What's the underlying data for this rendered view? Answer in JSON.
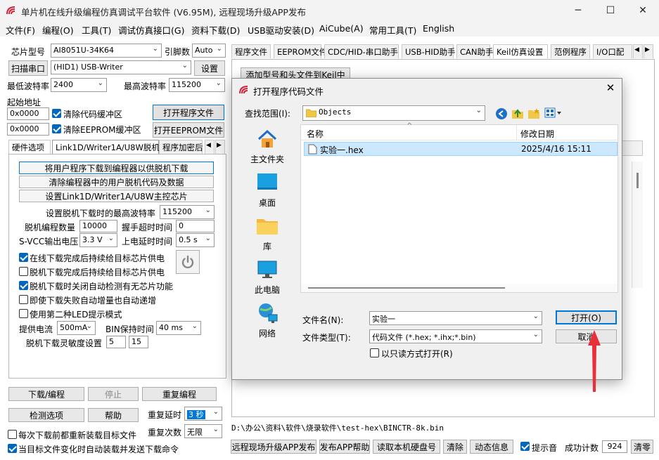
{
  "app": {
    "title": "单片机在线升级编程仿真调试平台软件 (V6.95M), 远程现场升级APP发布",
    "logo_icon": "stc-logo-icon"
  },
  "menu": [
    "文件(F)",
    "编程(O)",
    "工具(T)",
    "调试仿真接口(G)",
    "资料下载(D)",
    "USB驱动安装(D)",
    "AiCube(A)",
    "常用工具(T)",
    "English"
  ],
  "left": {
    "chip_label": "芯片型号",
    "chip_value": "AI8051U-34K64",
    "pins_label": "引脚数",
    "pins_value": "Auto",
    "scan_button": "扫描串口",
    "port_value": "(HID1) USB-Writer",
    "settings_button": "设置",
    "min_baud_label": "最低波特率",
    "min_baud_value": "2400",
    "max_baud_label": "最高波特率",
    "max_baud_value": "115200",
    "start_addr_label": "起始地址",
    "addr1": "0x0000",
    "clear_code_label": "清除代码缓冲区",
    "open_program_button": "打开程序文件",
    "addr2": "0x0000",
    "clear_eeprom_label": "清除EEPROM缓冲区",
    "open_eeprom_button": "打开EEPROM文件",
    "tabs": [
      "硬件选项",
      "Link1D/Writer1A/U8W脱机",
      "程序加密后"
    ],
    "offline_btn1": "将用户程序下载到编程器以供脱机下载",
    "offline_btn2": "清除编程器中的用户脱机代码及数据",
    "offline_btn3": "设置Link1D/Writer1A/U8W主控芯片",
    "offline_max_baud_label": "设置脱机下载时的最高波特率",
    "offline_max_baud_value": "115200",
    "offline_count_label": "脱机编程数量",
    "offline_count_value": "10000",
    "handshake_label": "握手超时时间",
    "handshake_value": "0",
    "svcc_label": "S-VCC输出电压",
    "svcc_value": "3.3 V",
    "power_delay_label": "上电延时时间",
    "power_delay_value": "0.5 s",
    "opt1": "在线下载完成后持续给目标芯片供电",
    "opt2": "脱机下载完成后持续给目标芯片供电",
    "opt3": "脱机下载时关闭自动检测有无芯片功能",
    "opt4": "即使下载失败自动增量也自动递增",
    "opt5": "使用第二种LED提示模式",
    "current_label": "提供电流",
    "current_value": "500mA",
    "bin_hold_label": "BIN保持时间",
    "bin_hold_value": "40 ms",
    "sensitivity_label": "脱机下载灵敏度设置",
    "sens1": "5",
    "sens2": "15",
    "download_button": "下载/编程",
    "stop_button": "停止",
    "reprogram_button": "重复编程",
    "detect_button": "检测选项",
    "help_button": "帮助",
    "repeat_delay_label": "重复延时",
    "repeat_delay_value": "3 秒",
    "repeat_count_label": "重复次数",
    "repeat_count_value": "无限",
    "reload_label": "每次下载前都重新装载目标文件",
    "auto_load_label": "当目标文件变化时自动装载并发送下载命令"
  },
  "right": {
    "tabs": [
      "程序文件",
      "EEPROM文件",
      "CDC/HID-串口助手",
      "USB-HID助手",
      "CAN助手",
      "Keil仿真设置",
      "范例程序",
      "I/O口配"
    ],
    "keil_button": "添加型号和头文件到Keil中",
    "path": "D:\\办公\\资料\\软件\\烧录软件\\test-hex\\BINCTR-8k.bin",
    "publish_button": "远程现场升级APP发布",
    "publish_help_button": "发布APP帮助",
    "read_disk_button": "读取本机硬盘号",
    "clear_button": "清除",
    "dynamic_button": "动态信息",
    "beep_label": "提示音",
    "success_label": "成功计数",
    "success_value": "924",
    "zero_button": "清零"
  },
  "dialog": {
    "title": "打开程序代码文件",
    "look_in_label": "查找范围(I):",
    "look_in_value": "Objects",
    "places": [
      "主文件夹",
      "桌面",
      "库",
      "此电脑",
      "网络"
    ],
    "col_name": "名称",
    "col_date": "修改日期",
    "files": [
      {
        "name": "实验一.hex",
        "date": "2025/4/16 15:11"
      }
    ],
    "filename_label": "文件名(N):",
    "filename_value": "实验一",
    "filetype_label": "文件类型(T):",
    "filetype_value": "代码文件 (*.hex;  *.ihx;*.bin)",
    "readonly_label": "以只读方式打开(R)",
    "open_button": "打开(O)",
    "cancel_button": "取消"
  },
  "colors": {
    "accent": "#0078d7",
    "arrow": "#e8303a",
    "selection": "#cce8ff"
  }
}
